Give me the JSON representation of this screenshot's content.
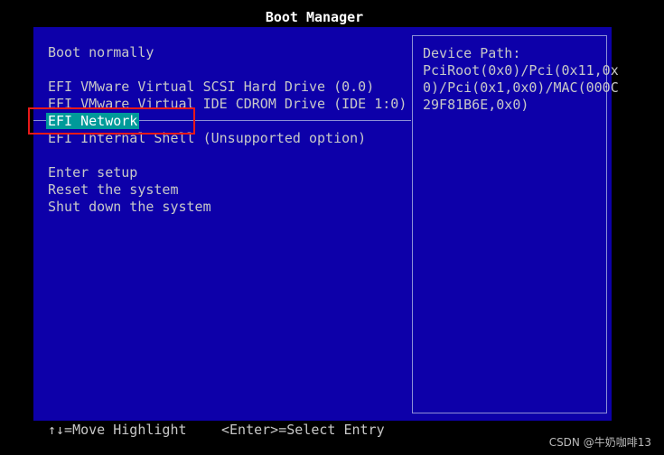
{
  "window": {
    "title": "Boot Manager"
  },
  "menu": {
    "items": [
      {
        "label": "Boot normally"
      },
      {
        "label": "EFI VMware Virtual SCSI Hard Drive (0.0)"
      },
      {
        "label": "EFI VMware Virtual IDE CDROM Drive (IDE 1:0)"
      },
      {
        "label": "EFI Network"
      },
      {
        "label": "EFI Internal Shell (Unsupported option)"
      },
      {
        "label": "Enter setup"
      },
      {
        "label": "Reset the system"
      },
      {
        "label": "Shut down the system"
      }
    ],
    "selected_label": "EFI Network"
  },
  "help_panel": {
    "heading": "Device Path:",
    "lines": [
      "PciRoot(0x0)/Pci(0x11,0x",
      "0)/Pci(0x1,0x0)/MAC(000C",
      "29F81B6E,0x0)"
    ]
  },
  "footer": {
    "move_hint": "↑↓=Move Highlight",
    "select_hint": "<Enter>=Select Entry"
  },
  "watermark": {
    "text": "CSDN @牛奶咖啡13"
  },
  "colors": {
    "panel_background": "#0d00a9",
    "selection_background": "#009a9a",
    "text": "#c8c8c8",
    "annotation_box": "#e81919"
  }
}
